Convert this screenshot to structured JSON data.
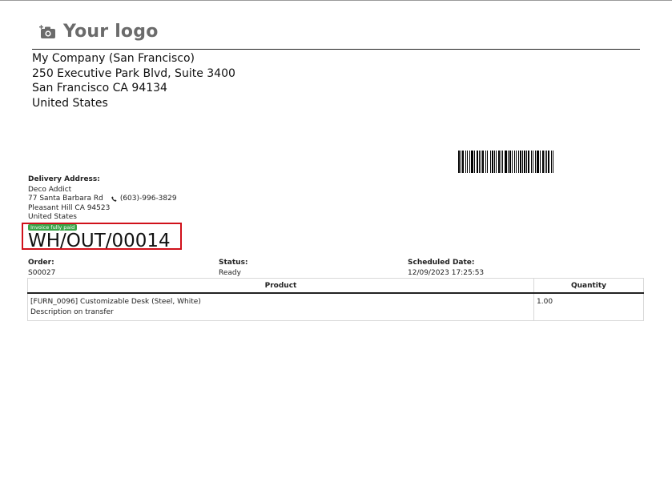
{
  "logo": {
    "text": "Your logo",
    "icon": "camera-plus-icon"
  },
  "company": {
    "name": "My Company (San Francisco)",
    "street": "250 Executive Park Blvd, Suite 3400",
    "city_line": "San Francisco CA 94134",
    "country": "United States"
  },
  "delivery": {
    "label": "Delivery Address:",
    "name": "Deco Addict",
    "street": "77 Santa Barbara Rd",
    "phone": "(603)-996-3829",
    "city_line": "Pleasant Hill CA 94523",
    "country": "United States"
  },
  "badge": {
    "text": "Invoice fully paid",
    "color": "#3aa447"
  },
  "document": {
    "name": "WH/OUT/00014"
  },
  "highlight_color": "#d0101a",
  "info": {
    "order_label": "Order:",
    "order_value": "S00027",
    "status_label": "Status:",
    "status_value": "Ready",
    "date_label": "Scheduled Date:",
    "date_value": "12/09/2023 17:25:53"
  },
  "table": {
    "headers": {
      "product": "Product",
      "quantity": "Quantity"
    },
    "rows": [
      {
        "product": "[FURN_0096] Customizable Desk (Steel, White)",
        "description": "Description on transfer",
        "quantity": "1.00"
      }
    ]
  }
}
